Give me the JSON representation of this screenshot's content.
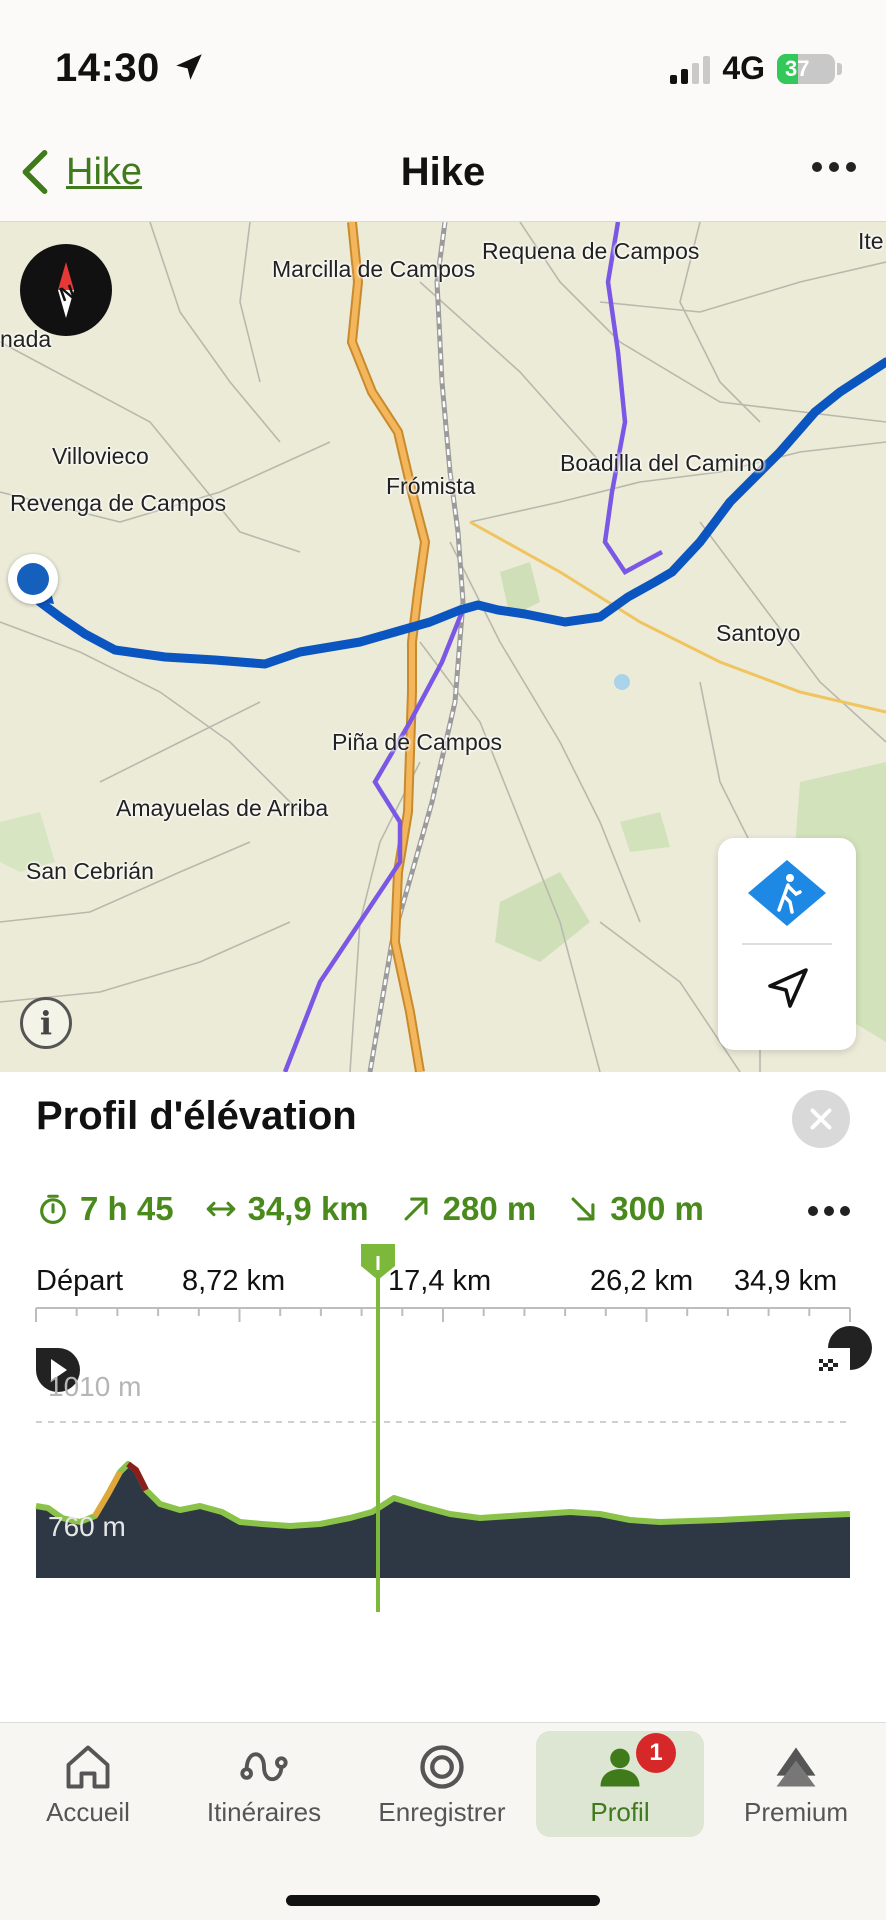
{
  "status_bar": {
    "time": "14:30",
    "network": "4G",
    "battery": "37"
  },
  "nav": {
    "back_label": "Hike",
    "title": "Hike"
  },
  "map": {
    "places": [
      "Ite",
      "Requena de Campos",
      "Marcilla de Campos",
      "nada",
      "Villovieco",
      "Boadilla del Camino",
      "Frómista",
      "Revenga de Campos",
      "Santoyo",
      "Piña de Campos",
      "Amayuelas de Arriba",
      "San Cebrián"
    ]
  },
  "elevation": {
    "title": "Profil d'élévation",
    "stats": {
      "duration": "7 h 45",
      "distance": "34,9 km",
      "ascent": "280 m",
      "descent": "300 m"
    },
    "distance_ticks": [
      "Départ",
      "8,72 km",
      "17,4 km",
      "26,2 km",
      "34,9 km"
    ],
    "elevation_labels": [
      "1010 m",
      "760 m"
    ]
  },
  "tabs": [
    {
      "label": "Accueil",
      "icon": "home-icon"
    },
    {
      "label": "Itinéraires",
      "icon": "route-icon"
    },
    {
      "label": "Enregistrer",
      "icon": "record-icon"
    },
    {
      "label": "Profil",
      "icon": "profile-icon",
      "badge": "1",
      "active": true
    },
    {
      "label": "Premium",
      "icon": "premium-icon"
    }
  ],
  "colors": {
    "accent": "#4a8a1c",
    "route": "#1560bd",
    "profile_line": "#8bc34a",
    "profile_fill": "#2e3744"
  }
}
